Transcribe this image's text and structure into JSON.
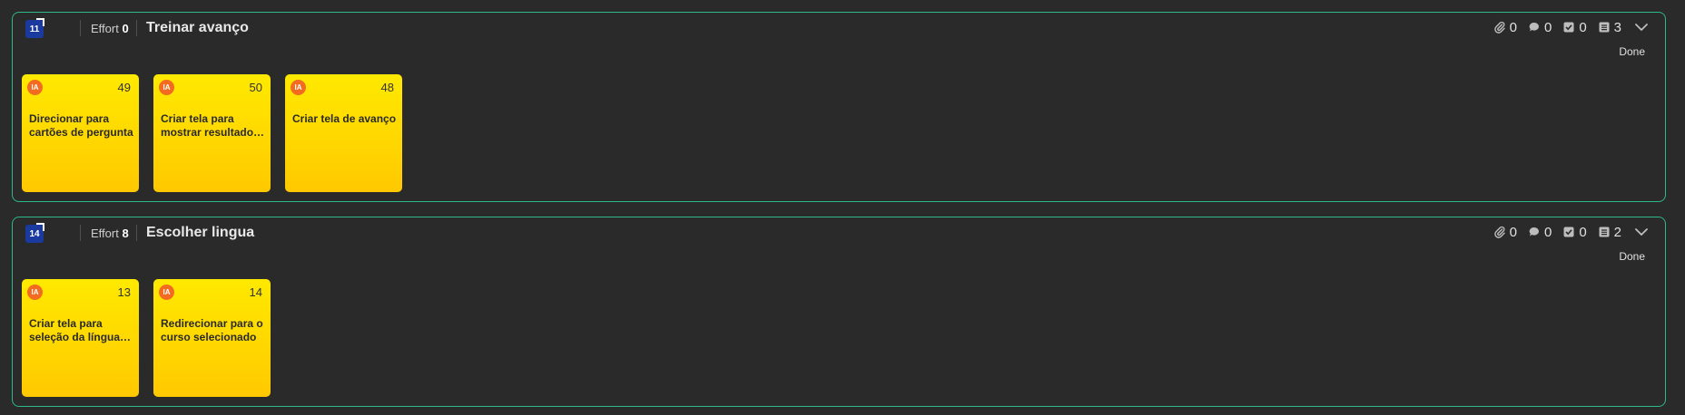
{
  "groups": [
    {
      "id": "11",
      "effort_label": "Effort",
      "effort_value": "0",
      "title": "Treinar avanço",
      "attachments": "0",
      "comments": "0",
      "checklists": "0",
      "items": "3",
      "status": "Done",
      "cards": [
        {
          "avatar": "IA",
          "number": "49",
          "title": "Direcionar para cartões de pergunta"
        },
        {
          "avatar": "IA",
          "number": "50",
          "title": "Criar tela para mostrar resultado final"
        },
        {
          "avatar": "IA",
          "number": "48",
          "title": "Criar tela de avanço"
        }
      ]
    },
    {
      "id": "14",
      "effort_label": "Effort",
      "effort_value": "8",
      "title": "Escolher lingua",
      "attachments": "0",
      "comments": "0",
      "checklists": "0",
      "items": "2",
      "status": "Done",
      "cards": [
        {
          "avatar": "IA",
          "number": "13",
          "title": "Criar tela para seleção da língua a aprender"
        },
        {
          "avatar": "IA",
          "number": "14",
          "title": "Redirecionar para o curso selecionado"
        }
      ]
    }
  ],
  "icons": {
    "attachments": "paperclip-icon",
    "comments": "comment-icon",
    "checklists": "checkbox-icon",
    "items": "list-icon",
    "collapse": "chevron-down-icon"
  },
  "colors": {
    "group_border": "#2fb98a",
    "card_yellow": "#ffe000",
    "badge_blue": "#1a3aa0",
    "avatar_orange": "#f36b21",
    "background": "#2a2a2a"
  }
}
